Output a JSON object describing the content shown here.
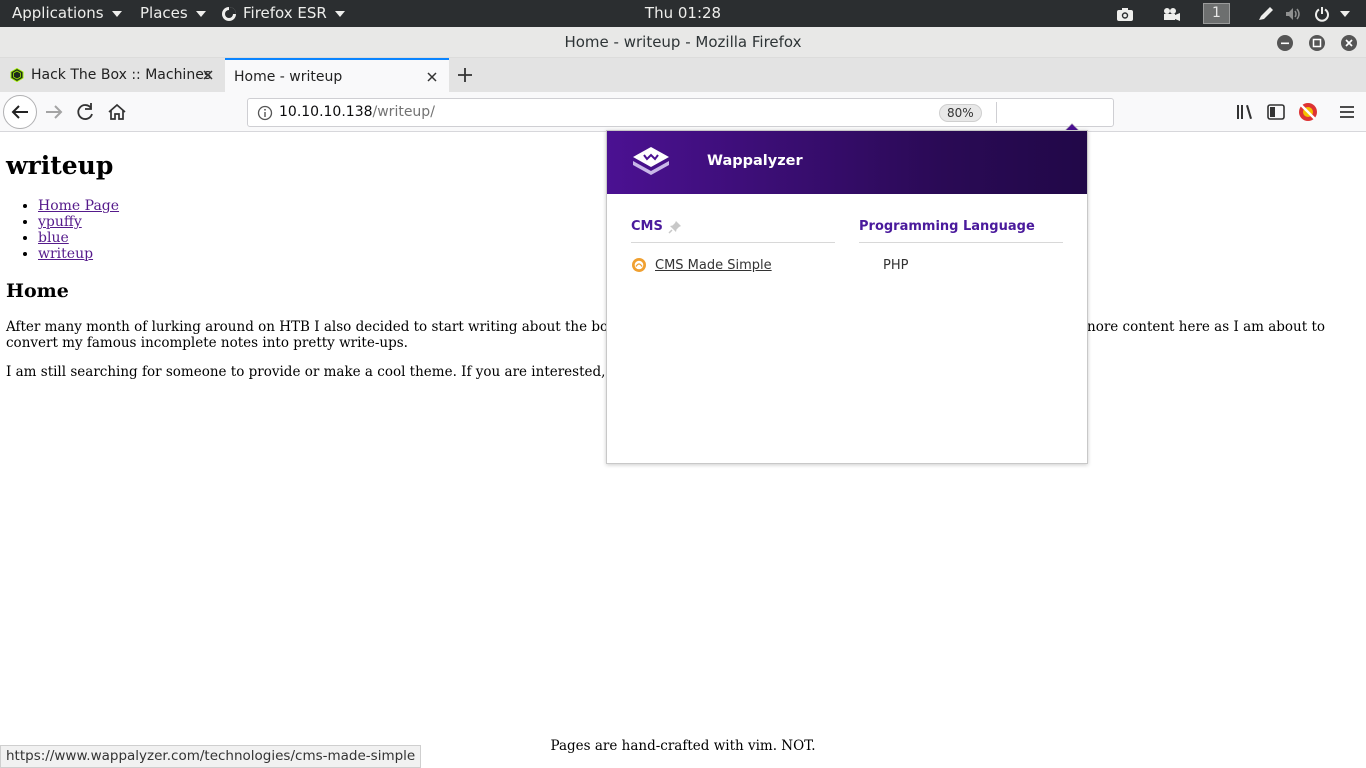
{
  "topbar": {
    "applications": "Applications",
    "places": "Places",
    "firefox_menu": "Firefox ESR",
    "clock": "Thu 01:28",
    "workspace": "1"
  },
  "window": {
    "title": "Home - writeup - Mozilla Firefox"
  },
  "tabs": [
    {
      "label": "Hack The Box :: Machines",
      "active": false
    },
    {
      "label": "Home - writeup",
      "active": true
    }
  ],
  "urlbar": {
    "host": "10.10.10.138",
    "path": "/writeup/",
    "zoom": "80%"
  },
  "page": {
    "title": "writeup",
    "nav": [
      "Home Page",
      "ypuffy",
      "blue",
      "writeup"
    ],
    "heading": "Home",
    "para1_left": "After many month of lurking around on HTB I also decided to start writing about the boxes I",
    "para1_right": "nore content here as I am about to",
    "para1_line2": "convert my famous incomplete notes into pretty write-ups.",
    "para2": "I am still searching for someone to provide or make a cool theme. If you are interested, plea",
    "footer": "Pages are hand-crafted with vim. NOT."
  },
  "statusbar": {
    "url": "https://www.wappalyzer.com/technologies/cms-made-simple"
  },
  "wappalyzer": {
    "brand": "Wappalyzer",
    "categories": [
      {
        "name": "CMS",
        "technologies": [
          "CMS Made Simple"
        ]
      },
      {
        "name": "Programming Language",
        "technologies": [
          "PHP"
        ]
      }
    ],
    "colors": {
      "header": "#4b1192",
      "accent": "#4a1a9c",
      "icon": "#f0a030"
    }
  }
}
